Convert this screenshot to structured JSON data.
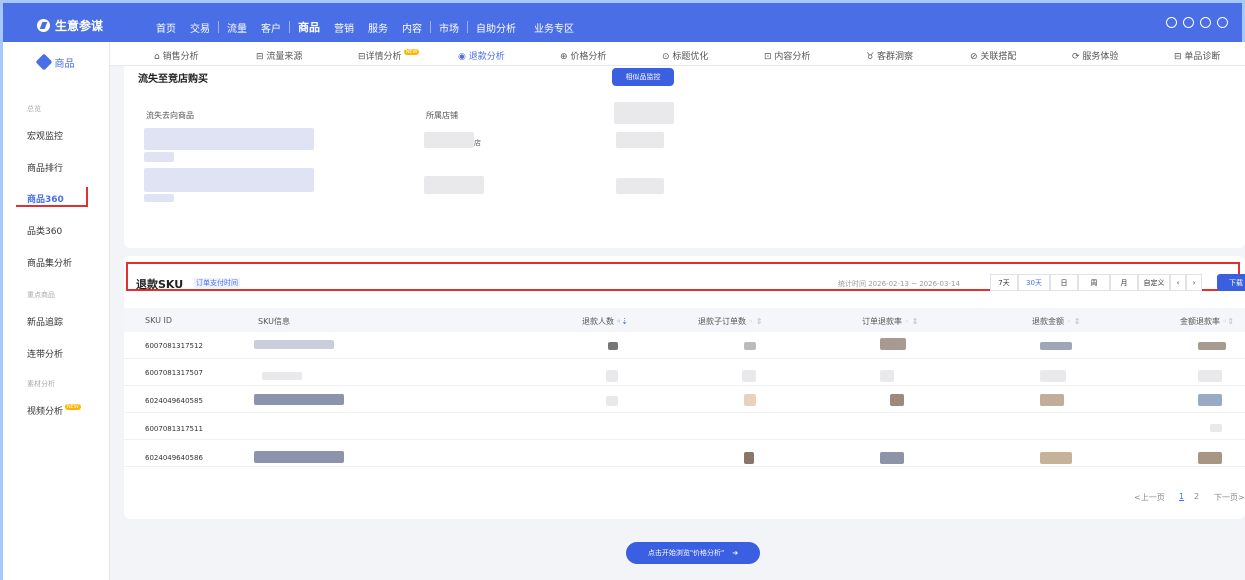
{
  "app": {
    "name": "生意参谋"
  },
  "nav": {
    "items": [
      "首页",
      "交易",
      "流量",
      "客户",
      "商品",
      "营销",
      "服务",
      "内容",
      "市场",
      "自助分析",
      "业务专区"
    ],
    "active": "商品"
  },
  "sidebar": {
    "header": "商品",
    "group_overview": "总览",
    "macro": "宏观监控",
    "rank": "商品排行",
    "p360": "商品360",
    "cat360": "品类360",
    "set": "商品集分析",
    "group_key": "重点商品",
    "newtrack": "新品追踪",
    "linked": "连带分析",
    "group_material": "素材分析",
    "video": "视频分析",
    "new_badge": "NEW"
  },
  "tabs": [
    "销售分析",
    "流量来源",
    "详情分析",
    "退款分析",
    "价格分析",
    "标题优化",
    "内容分析",
    "客群洞察",
    "关联搭配",
    "服务体验",
    "单品诊断"
  ],
  "tabs_selected": "退款分析",
  "section1": {
    "title": "流失至竞店购买",
    "button": "相似品监控",
    "col_goods": "流失去向商品",
    "col_shop": "所属店铺",
    "shop_fragment": "店"
  },
  "refund": {
    "title": "退款SKU",
    "tag": "订单支付时间",
    "stat_time": "统计时间 2026-02-13 ~ 2026-03-14",
    "ranges": [
      "7天",
      "30天",
      "日",
      "周",
      "月",
      "自定义"
    ],
    "range_selected": "30天",
    "download": "下载",
    "columns": [
      "SKU ID",
      "SKU信息",
      "退款人数",
      "退款子订单数",
      "订单退款率",
      "退款金额",
      "金额退款率"
    ],
    "rows": [
      {
        "id": "6007081317512"
      },
      {
        "id": "6007081317507"
      },
      {
        "id": "6024049640585"
      },
      {
        "id": "6007081317511"
      },
      {
        "id": "6024049640586"
      }
    ],
    "pager": {
      "prev": "<上一页",
      "p1": "1",
      "p2": "2",
      "next": "下一页>"
    }
  },
  "float_button": "点击开始浏览\"价格分析\""
}
